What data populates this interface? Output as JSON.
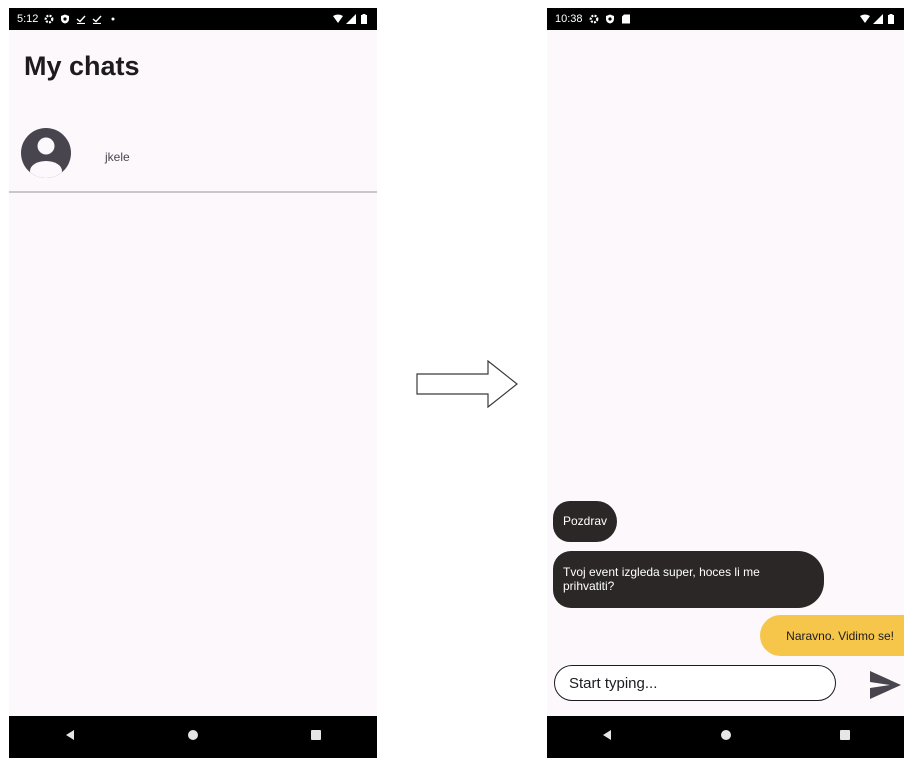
{
  "chat_list_screen": {
    "status_time": "5:12",
    "title": "My chats",
    "chats": [
      {
        "name": "jkele"
      }
    ]
  },
  "chat_screen": {
    "status_time": "10:38",
    "messages": [
      {
        "text": "Pozdrav",
        "direction": "received"
      },
      {
        "text": "Tvoj event izgleda super, hoces li me prihvatiti?",
        "direction": "received"
      },
      {
        "text": "Naravno. Vidimo se!",
        "direction": "sent"
      }
    ],
    "input": {
      "placeholder": "Start typing...",
      "value": ""
    }
  },
  "colors": {
    "background": "#fdf8fc",
    "received_bubble": "#2b2726",
    "sent_bubble": "#f6c64a",
    "divider": "#c9c6cc"
  }
}
